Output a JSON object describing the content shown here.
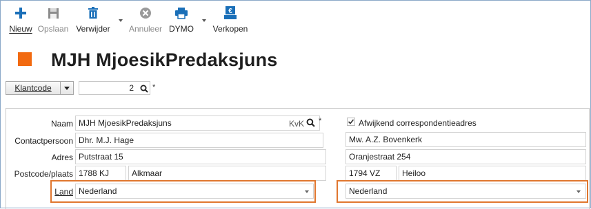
{
  "toolbar": {
    "new_label": "Nieuw",
    "save_label": "Opslaan",
    "delete_label": "Verwijder",
    "cancel_label": "Annuleer",
    "dymo_label": "DYMO",
    "sell_label": "Verkopen"
  },
  "header": {
    "title": "MJH MjoesikPredaksjuns",
    "accent_color": "#F26A10"
  },
  "search": {
    "type_label": "Klantcode",
    "code_value": "2",
    "required_mark": "*"
  },
  "form": {
    "left": {
      "name_label": "Naam",
      "name_value": "MJH MjoesikPredaksjuns",
      "kvk_label": "KvK",
      "name_required": "*",
      "contact_label": "Contactpersoon",
      "contact_value": "Dhr. M.J. Hage",
      "address_label": "Adres",
      "address_value": "Putstraat 15",
      "postcode_label": "Postcode/plaats",
      "postcode_value": "1788 KJ",
      "city_value": "Alkmaar",
      "country_label": "Land",
      "country_value": "Nederland"
    },
    "right": {
      "alt_address_label": "Afwijkend correspondentieadres",
      "alt_address_checked": true,
      "contact_value": "Mw. A.Z. Bovenkerk",
      "address_value": "Oranjestraat 254",
      "postcode_value": "1794 VZ",
      "city_value": "Heiloo",
      "country_value": "Nederland"
    }
  },
  "colors": {
    "toolbar_icon": "#1a6fb8",
    "highlight_border": "#E0762E"
  }
}
